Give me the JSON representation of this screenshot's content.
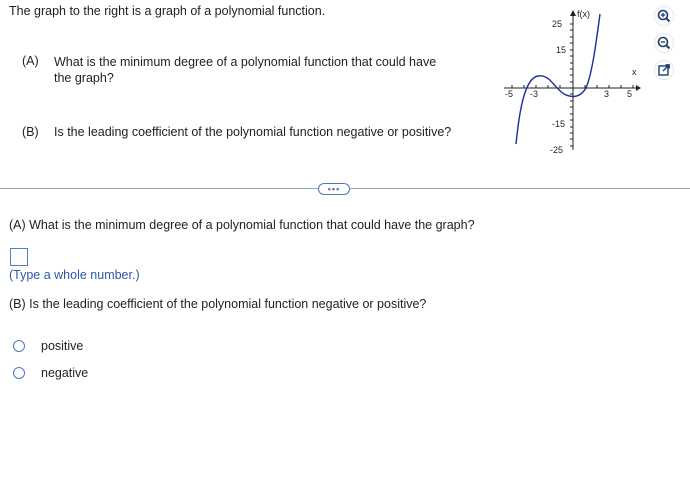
{
  "intro": "The graph to the right is a graph of a polynomial function.",
  "part_a": {
    "label": "(A)",
    "question_line1": "What is the minimum degree of a polynomial function that could have",
    "question_line2": "the graph?"
  },
  "part_b": {
    "label": "(B)",
    "question": "Is the leading coefficient of the polynomial function negative or positive?"
  },
  "graph": {
    "y_axis_label": "f(x)",
    "x_axis_label": "x",
    "y_ticks": [
      "25",
      "15",
      "-15",
      "-25"
    ],
    "x_ticks": [
      "-5",
      "-3",
      "3",
      "5"
    ],
    "curve_color": "#1c2c9c"
  },
  "tools": [
    "zoom-in-icon",
    "zoom-out-icon",
    "popout-icon"
  ],
  "expand_label": "•••",
  "answer": {
    "question_a": "(A) What is the minimum degree of a polynomial function that could have the graph?",
    "input_value": "",
    "hint": "(Type a whole number.)",
    "question_b": "(B) Is the leading coefficient of the polynomial function negative or positive?",
    "options": [
      "positive",
      "negative"
    ]
  },
  "colors": {
    "accent": "#4a7bc6",
    "hint": "#2d57a5",
    "divider": "#9aa3ad"
  }
}
